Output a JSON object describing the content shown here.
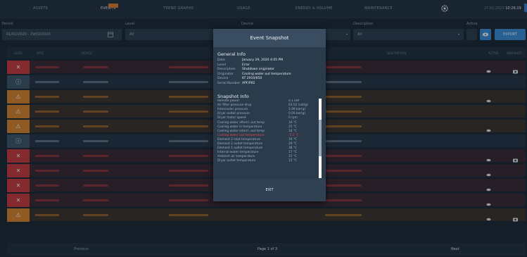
{
  "nav": {
    "items": [
      "ASSETS",
      "EVENTS",
      "TREND GRAPHS",
      "USAGE",
      "ENERGY & VOLUME",
      "MAINTENANCE"
    ],
    "badge": "",
    "date": "27.02.2020",
    "time": "10:26:19"
  },
  "filters": {
    "period_label": "Period",
    "period_value": "01/02/2020 - 29/02/2020",
    "level_label": "Level",
    "level_value": "All",
    "device_label": "Device",
    "description_label": "Description",
    "description_value": "All",
    "active_label": "Active",
    "export_label": "EXPORT"
  },
  "table": {
    "headers": [
      "LEVEL",
      "DATE",
      "DEVICE",
      "DESCRIPTION",
      "ACTIVE",
      "SNAPSHOT"
    ],
    "rows": [
      {
        "level": "error",
        "level_icon": "x-icon"
      },
      {
        "level": "info",
        "level_icon": "info-icon"
      },
      {
        "level": "warning",
        "level_icon": "warning-icon"
      },
      {
        "level": "warning",
        "level_icon": "warning-icon"
      },
      {
        "level": "warning",
        "level_icon": "warning-icon"
      },
      {
        "level": "info",
        "level_icon": "info-icon"
      },
      {
        "level": "error",
        "level_icon": "x-icon"
      },
      {
        "level": "error",
        "level_icon": "x-icon"
      },
      {
        "level": "error",
        "level_icon": "x-icon"
      },
      {
        "level": "error",
        "level_icon": "x-icon"
      },
      {
        "level": "warning",
        "level_icon": "warning-icon"
      }
    ]
  },
  "pagination": {
    "previous": "Previous",
    "page": "Page 1 of 3",
    "next": "Next"
  },
  "modal": {
    "title": "Event Snapshot",
    "general_title": "General Info",
    "general": [
      {
        "label": "Date",
        "value": "January 29, 2020 4:05 PM"
      },
      {
        "label": "Level",
        "value": "Error"
      },
      {
        "label": "Description",
        "value": "Shutdown originator"
      },
      {
        "label": "Originator",
        "value": "Cooling water out temperature"
      },
      {
        "label": "Device",
        "value": "KT 2910/650"
      },
      {
        "label": "Serial Number",
        "value": "APF/P02"
      }
    ],
    "snapshot_title": "Snapshot Info",
    "snapshot": [
      {
        "label": "Remote power",
        "value": "0.1 kW",
        "highlight": false
      },
      {
        "label": "Air filter pressure drop",
        "value": "63.52 (sat/g)",
        "highlight": false
      },
      {
        "label": "Intercooler pressure",
        "value": "1.09 bar(g)",
        "highlight": false
      },
      {
        "label": "Dryer outlet pressure",
        "value": "0.00 bar(g)",
        "highlight": false
      },
      {
        "label": "Dryer motor speed",
        "value": "0 rpm",
        "highlight": false
      },
      {
        "label": "Cooling water aftercl. out temp.",
        "value": "16 °C",
        "highlight": false
      },
      {
        "label": "Cooling water in temperature",
        "value": "25 °C",
        "highlight": false
      },
      {
        "label": "Cooling water intercl. out temp.",
        "value": "18 °C",
        "highlight": false
      },
      {
        "label": "Cooling water out temperature",
        "value": "-5.5 °C",
        "highlight": true
      },
      {
        "label": "Element 2 inlet temperature",
        "value": "19 °C",
        "highlight": false
      },
      {
        "label": "Element 2 outlet temperature",
        "value": "29 °C",
        "highlight": false
      },
      {
        "label": "Element 1 outlet temperature",
        "value": "38 °C",
        "highlight": false
      },
      {
        "label": "Internal water temperature",
        "value": "17 °C",
        "highlight": false
      },
      {
        "label": "Ambient air temperature",
        "value": "15 °C",
        "highlight": false
      },
      {
        "label": "Dryer outlet temperature",
        "value": "15 °C",
        "highlight": false
      }
    ],
    "exit_label": "EXIT"
  },
  "colors": {
    "accent": "#3a8ad8",
    "error": "#c8383d",
    "warning": "#d9822b",
    "info": "#3d5266",
    "badge": "#e07b2a"
  }
}
